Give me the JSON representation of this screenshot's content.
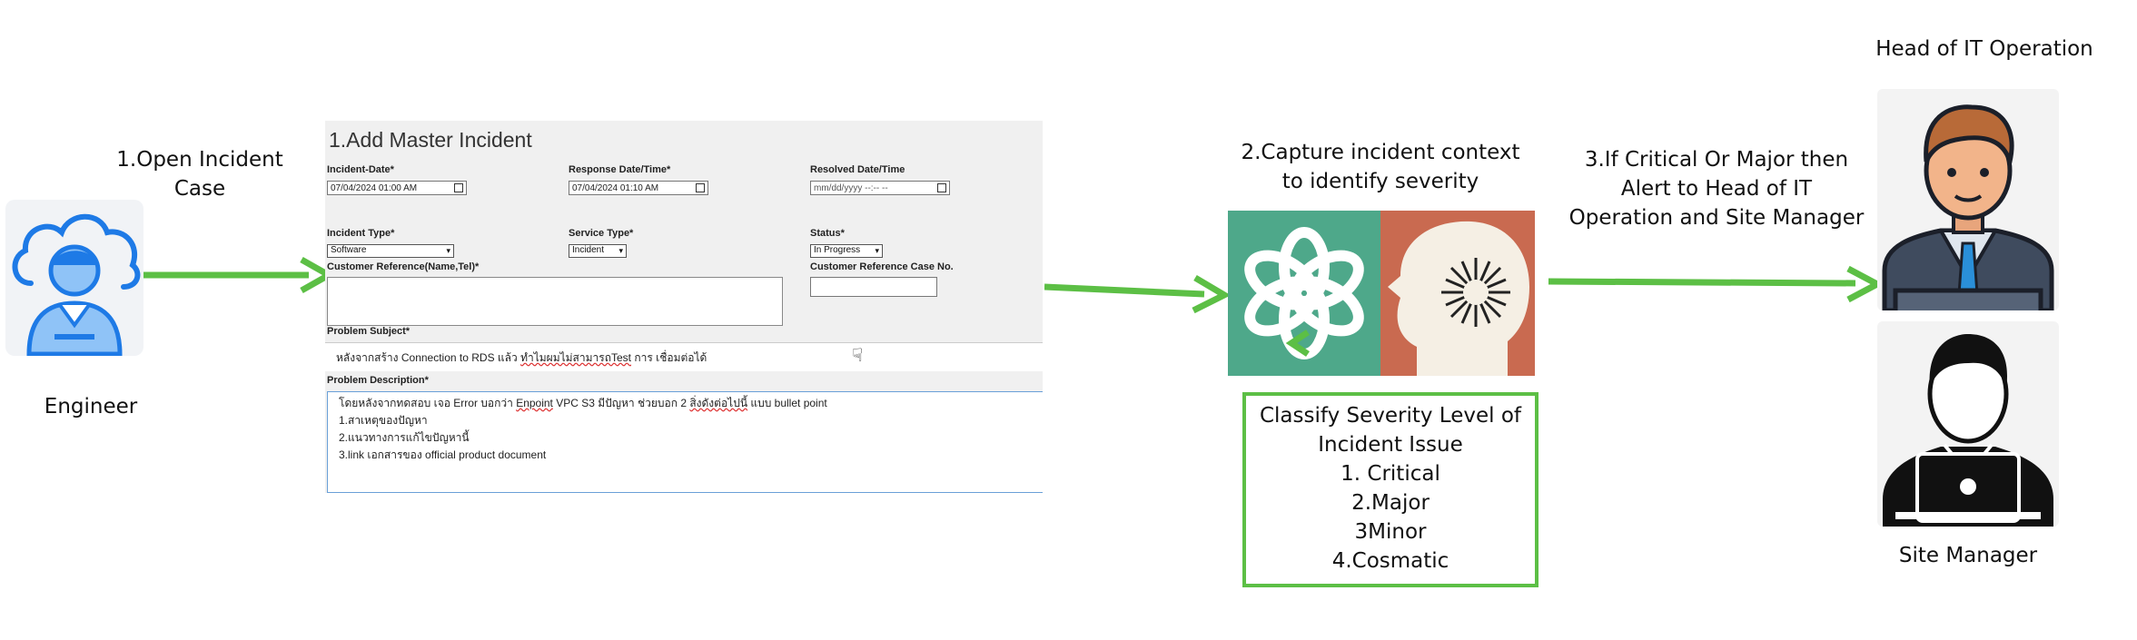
{
  "engineer": {
    "label": "Engineer",
    "icon": "engineer-cloud-icon"
  },
  "step1": {
    "line1": "1.Open Incident",
    "line2": "Case"
  },
  "form": {
    "title": "1.Add Master Incident",
    "incident_date": {
      "label": "Incident-Date*",
      "value": "07/04/2024 01:00  AM"
    },
    "response_date": {
      "label": "Response Date/Time*",
      "value": "07/04/2024 01:10  AM"
    },
    "resolved_date": {
      "label": "Resolved Date/Time",
      "placeholder": "mm/dd/yyyy --:-- --"
    },
    "incident_type": {
      "label": "Incident Type*",
      "value": "Software"
    },
    "service_type": {
      "label": "Service Type*",
      "value": "Incident"
    },
    "status": {
      "label": "Status*",
      "value": "In Progress"
    },
    "customer_reference": {
      "label": "Customer Reference(Name,Tel)*",
      "value": ""
    },
    "customer_case_no": {
      "label": "Customer Reference Case No.",
      "value": ""
    },
    "problem_subject": {
      "label": "Problem Subject*",
      "value_part1": "หลังจากสร้าง Connection to RDS แล้ว ",
      "value_part2": "ทำไมผมไม่สามารถTest",
      "value_part3": " การ เชื่อมต่อได้"
    },
    "problem_description": {
      "label": "Problem Description*",
      "line1_part1": "โดยหลังจากทดสอบ เจอ Error บอกว่า ",
      "line1_part2": "Enpoint",
      "line1_part3": " VPC S3 มีปัญหา ช่วยบอก 2 ",
      "line1_part4": "สิ่งดังต่อไปนี้",
      "line1_part5": " แบบ bullet point",
      "line2": "1.สาเหตุของปัญหา",
      "line3": "2.แนวทางการแก้ไขปัญหานี้",
      "line4": "3.link เอกสารของ official product document"
    }
  },
  "step2": {
    "line1": "2.Capture incident context",
    "line2": "to identify severity"
  },
  "ai_logos": [
    {
      "icon": "openai-logo-icon",
      "color": "#4ea88a"
    },
    {
      "icon": "claude-head-icon",
      "color": "#c96a50"
    }
  ],
  "severity": {
    "title_line1": "Classify Severity Level of",
    "title_line2": "Incident Issue",
    "levels": [
      "1. Critical",
      "2.Major",
      "3Minor",
      "4.Cosmatic"
    ]
  },
  "step3": {
    "line1": "3.If Critical Or Major then",
    "line2": "Alert to Head of IT",
    "line3": "Operation and Site Manager"
  },
  "head_it": {
    "label": "Head of IT Operation",
    "icon": "businessman-icon"
  },
  "site_manager": {
    "label": "Site Manager",
    "icon": "manager-laptop-icon"
  },
  "colors": {
    "arrow": "#5cbf45",
    "engineer_blue": "#1e7ae6"
  }
}
